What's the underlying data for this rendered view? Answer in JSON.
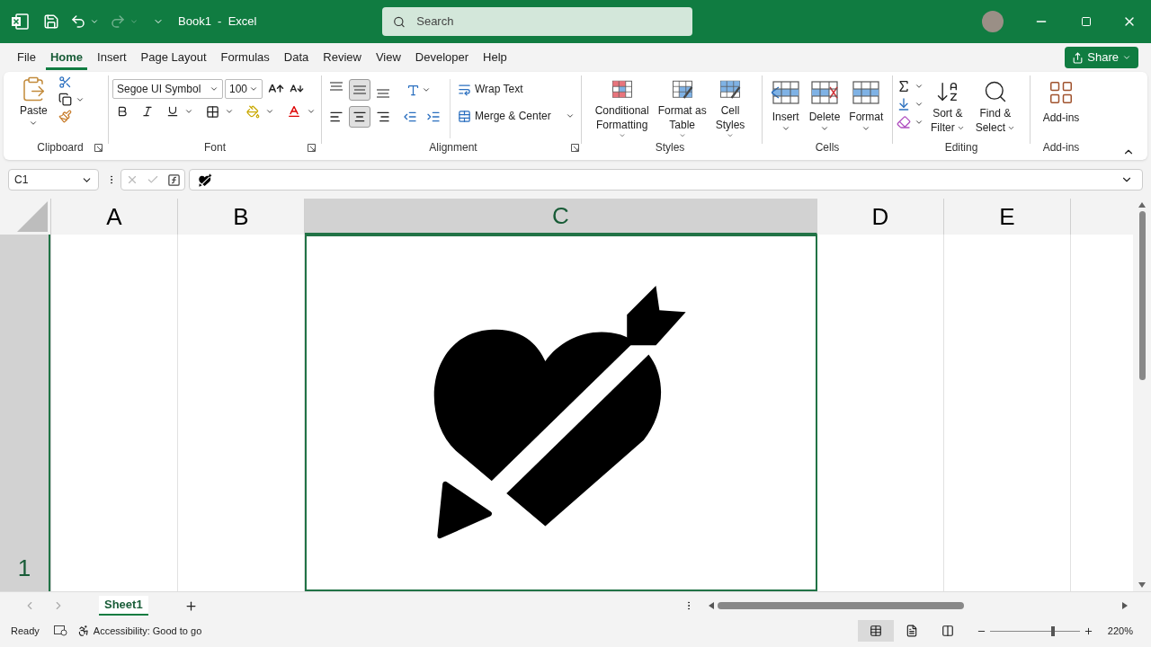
{
  "window": {
    "title": "Book1  -  Excel"
  },
  "search": {
    "placeholder": "Search"
  },
  "tabs": [
    {
      "label": "File",
      "selected": false
    },
    {
      "label": "Home",
      "selected": true
    },
    {
      "label": "Insert",
      "selected": false
    },
    {
      "label": "Page Layout",
      "selected": false
    },
    {
      "label": "Formulas",
      "selected": false
    },
    {
      "label": "Data",
      "selected": false
    },
    {
      "label": "Review",
      "selected": false
    },
    {
      "label": "View",
      "selected": false
    },
    {
      "label": "Developer",
      "selected": false
    },
    {
      "label": "Help",
      "selected": false
    }
  ],
  "share": {
    "label": "Share"
  },
  "ribbon": {
    "clipboard": {
      "label": "Clipboard",
      "paste": "Paste"
    },
    "font": {
      "label": "Font",
      "name": "Segoe UI Symbol",
      "size": "100"
    },
    "alignment": {
      "label": "Alignment",
      "vertical": [
        {
          "kind": "top",
          "on": false
        },
        {
          "kind": "middle",
          "on": true
        },
        {
          "kind": "bottom",
          "on": false
        }
      ],
      "horizontal": [
        {
          "kind": "left",
          "on": false
        },
        {
          "kind": "center",
          "on": true
        },
        {
          "kind": "right",
          "on": false
        }
      ],
      "wrap": "Wrap Text",
      "merge": "Merge & Center"
    },
    "styles": {
      "label": "Styles",
      "buttons": [
        {
          "kind": "conditional",
          "lines": [
            "Conditional",
            "Formatting"
          ]
        },
        {
          "kind": "table",
          "lines": [
            "Format as",
            "Table"
          ]
        },
        {
          "kind": "cellstyles",
          "lines": [
            "Cell",
            "Styles"
          ]
        }
      ]
    },
    "cells": {
      "label": "Cells",
      "buttons": [
        {
          "kind": "insert",
          "lines": [
            "Insert"
          ]
        },
        {
          "kind": "delete",
          "lines": [
            "Delete"
          ]
        },
        {
          "kind": "format",
          "lines": [
            "Format"
          ]
        }
      ]
    },
    "editing": {
      "label": "Editing",
      "buttons": [
        {
          "kind": "sort",
          "lines": [
            "Sort &",
            "Filter"
          ]
        },
        {
          "kind": "find",
          "lines": [
            "Find &",
            "Select"
          ]
        }
      ]
    },
    "addins": {
      "label": "Add-ins",
      "button": "Add-ins"
    }
  },
  "name_box": "C1",
  "columns": [
    {
      "label": "A",
      "selected": false
    },
    {
      "label": "B",
      "selected": false
    },
    {
      "label": "C",
      "selected": true
    },
    {
      "label": "D",
      "selected": false
    },
    {
      "label": "E",
      "selected": false
    }
  ],
  "rows": [
    {
      "label": "1"
    }
  ],
  "sheets": [
    {
      "label": "Sheet1",
      "selected": true
    }
  ],
  "status_bar": {
    "ready": "Ready",
    "accessibility": "Accessibility: Good to go",
    "zoom": "220%",
    "zoom_slider": {
      "level": 0.7
    },
    "views": [
      {
        "kind": "normal",
        "selected": true
      },
      {
        "kind": "layout",
        "selected": false
      },
      {
        "kind": "pagebreak",
        "selected": false
      }
    ]
  }
}
